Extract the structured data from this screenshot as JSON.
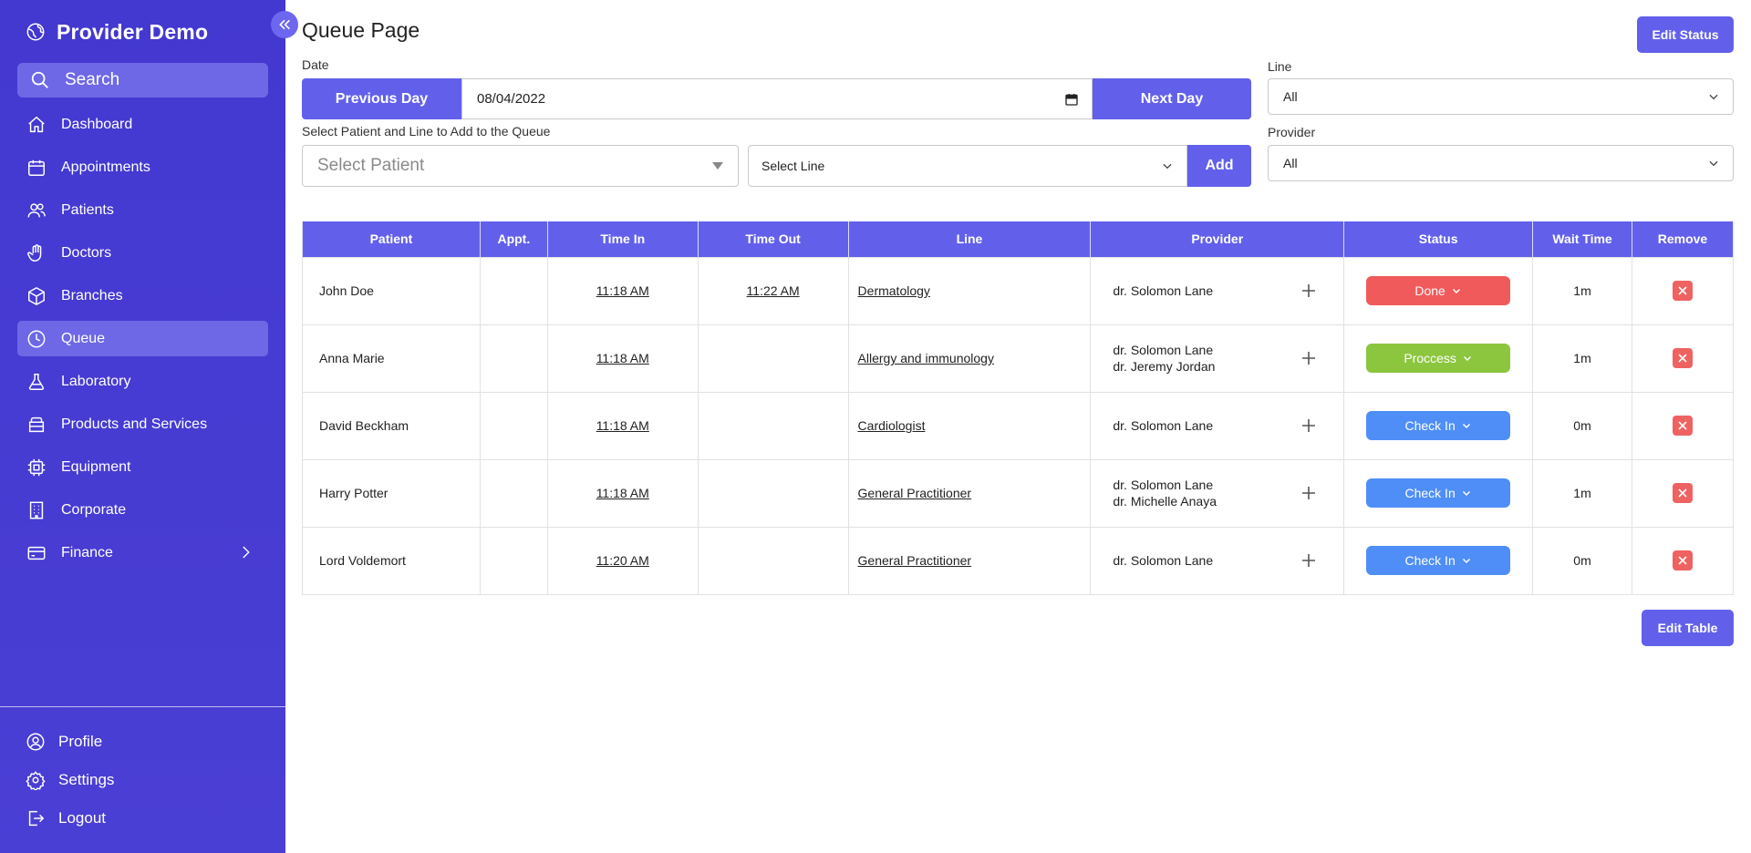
{
  "app": {
    "title": "Provider Demo"
  },
  "sidebar": {
    "search_label": "Search",
    "items": [
      {
        "label": "Dashboard",
        "icon": "home-icon"
      },
      {
        "label": "Appointments",
        "icon": "calendar-icon"
      },
      {
        "label": "Patients",
        "icon": "users-icon"
      },
      {
        "label": "Doctors",
        "icon": "hand-icon"
      },
      {
        "label": "Branches",
        "icon": "cube-icon"
      },
      {
        "label": "Queue",
        "icon": "clock-icon",
        "active": true
      },
      {
        "label": "Laboratory",
        "icon": "flask-icon"
      },
      {
        "label": "Products and Services",
        "icon": "box-icon"
      },
      {
        "label": "Equipment",
        "icon": "chip-icon"
      },
      {
        "label": "Corporate",
        "icon": "building-icon"
      },
      {
        "label": "Finance",
        "icon": "card-icon"
      }
    ],
    "bottom": [
      {
        "label": "Profile",
        "icon": "user-circle-icon"
      },
      {
        "label": "Settings",
        "icon": "gear-icon"
      },
      {
        "label": "Logout",
        "icon": "logout-icon"
      }
    ]
  },
  "main": {
    "title": "Queue Page",
    "edit_status_label": "Edit Status",
    "date_label": "Date",
    "prev_day_label": "Previous Day",
    "date_value": "08/04/2022",
    "next_day_label": "Next Day",
    "add_label_text": "Select Patient and Line to Add to the Queue",
    "select_patient_placeholder": "Select Patient",
    "select_line_value": "Select Line",
    "add_button": "Add",
    "line_label": "Line",
    "line_value": "All",
    "provider_label": "Provider",
    "provider_value": "All",
    "edit_table_label": "Edit Table"
  },
  "table": {
    "headers": [
      "Patient",
      "Appt.",
      "Time In",
      "Time Out",
      "Line",
      "Provider",
      "Status",
      "Wait Time",
      "Remove"
    ],
    "rows": [
      {
        "patient": "John Doe",
        "appt": "",
        "time_in": "11:18 AM",
        "time_out": "11:22 AM",
        "line": "Dermatology",
        "provider1": "dr. Solomon Lane",
        "provider2": "",
        "status": "Done",
        "wait": "1m"
      },
      {
        "patient": "Anna Marie",
        "appt": "",
        "time_in": "11:18 AM",
        "time_out": "",
        "line": "Allergy and immunology",
        "provider1": "dr. Solomon Lane",
        "provider2": "dr. Jeremy Jordan",
        "status": "Proccess",
        "wait": "1m"
      },
      {
        "patient": "David Beckham",
        "appt": "",
        "time_in": "11:18 AM",
        "time_out": "",
        "line": "Cardiologist",
        "provider1": "dr. Solomon Lane",
        "provider2": "",
        "status": "Check In",
        "wait": "0m"
      },
      {
        "patient": "Harry Potter",
        "appt": "",
        "time_in": "11:18 AM",
        "time_out": "",
        "line": "General Practitioner",
        "provider1": "dr. Solomon Lane",
        "provider2": "dr. Michelle Anaya",
        "status": "Check In",
        "wait": "1m"
      },
      {
        "patient": "Lord Voldemort",
        "appt": "",
        "time_in": "11:20 AM",
        "time_out": "",
        "line": "General Practitioner",
        "provider1": "dr. Solomon Lane",
        "provider2": "",
        "status": "Check In",
        "wait": "0m"
      }
    ]
  },
  "colors": {
    "sidebar": "#4338ca",
    "primary": "#6260eb",
    "status_done": "#f05a5a",
    "status_process": "#8cc63f",
    "status_checkin": "#4f8ef7",
    "remove": "#ef6262"
  }
}
